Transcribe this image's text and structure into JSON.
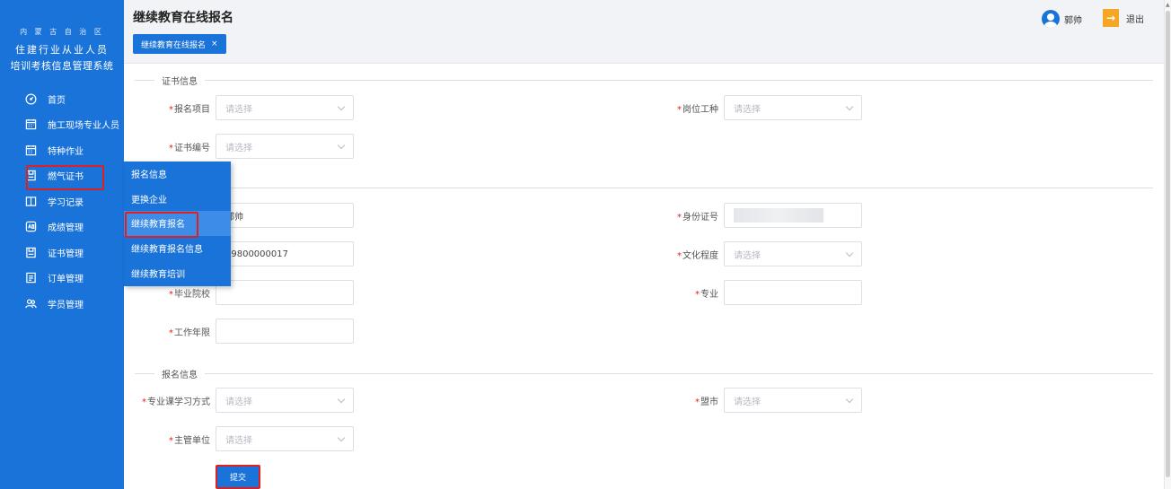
{
  "brand": {
    "line1": "内 蒙 古 自 治 区",
    "line2": "住建行业从业人员",
    "line3": "培训考核信息管理系统"
  },
  "sidebar": {
    "items": [
      {
        "label": "首页",
        "icon": "dashboard-icon"
      },
      {
        "label": "施工现场专业人员",
        "icon": "calendar-icon"
      },
      {
        "label": "特种作业",
        "icon": "calendar-icon"
      },
      {
        "label": "燃气证书",
        "icon": "certificate-icon"
      },
      {
        "label": "学习记录",
        "icon": "book-icon"
      },
      {
        "label": "成绩管理",
        "icon": "score-icon"
      },
      {
        "label": "证书管理",
        "icon": "certificate-icon"
      },
      {
        "label": "订单管理",
        "icon": "order-icon"
      },
      {
        "label": "学员管理",
        "icon": "users-icon"
      }
    ]
  },
  "flyout": {
    "items": [
      "报名信息",
      "更换企业",
      "继续教育报名",
      "继续教育报名信息",
      "继续教育培训"
    ]
  },
  "header": {
    "title": "继续教育在线报名",
    "tab_label": "继续教育在线报名",
    "tab_close": "×",
    "user_name": "郭帅",
    "logout_label": "退出"
  },
  "form": {
    "sections": [
      "证书信息",
      "报名信息"
    ],
    "placeholder": "请选择",
    "fields": {
      "project": {
        "label": "报名项目"
      },
      "post": {
        "label": "岗位工种"
      },
      "cert_no": {
        "label": "证书编号"
      },
      "name": {
        "value": "郭帅"
      },
      "id_no": {
        "label": "身份证号"
      },
      "phone": {
        "value": "19800000017"
      },
      "education": {
        "label": "文化程度"
      },
      "school": {
        "label": "毕业院校"
      },
      "major": {
        "label": "专业"
      },
      "work_years": {
        "label": "工作年限"
      },
      "study_mode": {
        "label": "专业课学习方式"
      },
      "city": {
        "label": "盟市"
      },
      "authority": {
        "label": "主管单位"
      }
    },
    "submit_label": "提交"
  },
  "colors": {
    "primary": "#1a73d9",
    "highlight": "#e02020",
    "logout": "#f5a623"
  }
}
